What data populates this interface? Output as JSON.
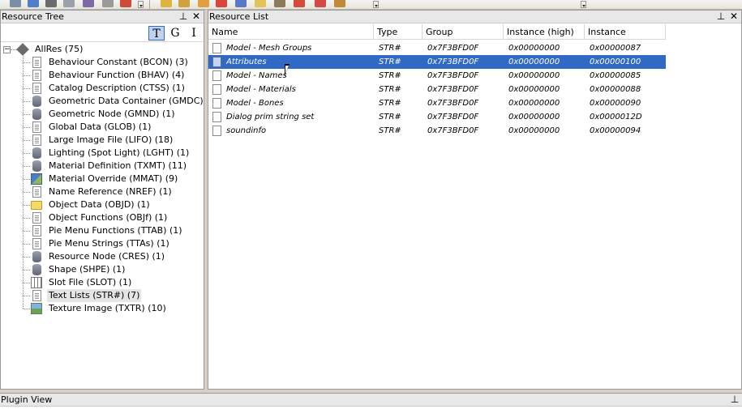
{
  "toolbar": {
    "icons": [
      "new-document-icon",
      "open-icon",
      "save-icon",
      "close-icon",
      "export-icon",
      "settings-icon",
      "delete-icon",
      "copy-icon",
      "paste-icon",
      "package-icon",
      "remove-icon",
      "tag-icon",
      "link-icon",
      "wrench-icon",
      "cut-icon",
      "x-icon",
      "edit-icon"
    ]
  },
  "tree_panel": {
    "title": "Resource Tree",
    "pin_glyph": "⊥",
    "close_glyph": "✕",
    "tools": [
      {
        "label": "T",
        "active": true
      },
      {
        "label": "G",
        "active": false
      },
      {
        "label": "I",
        "active": false
      }
    ],
    "root": {
      "label": "AllRes (75)",
      "expander": "−"
    },
    "items": [
      {
        "label": "Behaviour Constant (BCON) (3)",
        "icon": "document-icon",
        "selected": false
      },
      {
        "label": "Behaviour Function (BHAV) (4)",
        "icon": "document-icon",
        "selected": false
      },
      {
        "label": "Catalog Description (CTSS) (1)",
        "icon": "document-icon",
        "selected": false
      },
      {
        "label": "Geometric Data Container (GMDC) (1)",
        "icon": "database-icon",
        "selected": false
      },
      {
        "label": "Geometric Node (GMND) (1)",
        "icon": "database-icon",
        "selected": false
      },
      {
        "label": "Global Data (GLOB) (1)",
        "icon": "document-icon",
        "selected": false
      },
      {
        "label": "Large Image File (LIFO) (18)",
        "icon": "document-icon",
        "selected": false
      },
      {
        "label": "Lighting (Spot Light) (LGHT) (1)",
        "icon": "database-icon",
        "selected": false
      },
      {
        "label": "Material Definition (TXMT) (11)",
        "icon": "database-icon",
        "selected": false
      },
      {
        "label": "Material Override (MMAT) (9)",
        "icon": "material-icon",
        "selected": false
      },
      {
        "label": "Name Reference (NREF) (1)",
        "icon": "document-icon",
        "selected": false
      },
      {
        "label": "Object Data (OBJD) (1)",
        "icon": "folder-icon",
        "selected": false
      },
      {
        "label": "Object Functions (OBJf) (1)",
        "icon": "document-icon",
        "selected": false
      },
      {
        "label": "Pie Menu Functions (TTAB) (1)",
        "icon": "document-icon",
        "selected": false
      },
      {
        "label": "Pie Menu Strings (TTAs) (1)",
        "icon": "document-icon",
        "selected": false
      },
      {
        "label": "Resource Node (CRES) (1)",
        "icon": "database-icon",
        "selected": false
      },
      {
        "label": "Shape (SHPE) (1)",
        "icon": "database-icon",
        "selected": false
      },
      {
        "label": "Slot File (SLOT) (1)",
        "icon": "grid-icon",
        "selected": false
      },
      {
        "label": "Text Lists (STR#) (7)",
        "icon": "document-icon",
        "selected": true
      },
      {
        "label": "Texture Image (TXTR) (10)",
        "icon": "image-icon",
        "selected": false
      }
    ]
  },
  "list_panel": {
    "title": "Resource List",
    "pin_glyph": "⊥",
    "close_glyph": "✕",
    "columns": [
      "Name",
      "Type",
      "Group",
      "Instance (high)",
      "Instance"
    ],
    "rows": [
      {
        "name": "Model - Mesh Groups",
        "type": "STR#",
        "group": "0x7F3BFD0F",
        "instance_high": "0x00000000",
        "instance": "0x00000087",
        "selected": false
      },
      {
        "name": "Attributes",
        "type": "STR#",
        "group": "0x7F3BFD0F",
        "instance_high": "0x00000000",
        "instance": "0x00000100",
        "selected": true
      },
      {
        "name": "Model - Names",
        "type": "STR#",
        "group": "0x7F3BFD0F",
        "instance_high": "0x00000000",
        "instance": "0x00000085",
        "selected": false
      },
      {
        "name": "Model - Materials",
        "type": "STR#",
        "group": "0x7F3BFD0F",
        "instance_high": "0x00000000",
        "instance": "0x00000088",
        "selected": false
      },
      {
        "name": "Model - Bones",
        "type": "STR#",
        "group": "0x7F3BFD0F",
        "instance_high": "0x00000000",
        "instance": "0x00000090",
        "selected": false
      },
      {
        "name": "Dialog prim string set",
        "type": "STR#",
        "group": "0x7F3BFD0F",
        "instance_high": "0x00000000",
        "instance": "0x0000012D",
        "selected": false
      },
      {
        "name": "soundinfo",
        "type": "STR#",
        "group": "0x7F3BFD0F",
        "instance_high": "0x00000000",
        "instance": "0x00000094",
        "selected": false
      }
    ]
  },
  "plugin_panel": {
    "title": "Plugin View",
    "pin_glyph": "⊥"
  }
}
